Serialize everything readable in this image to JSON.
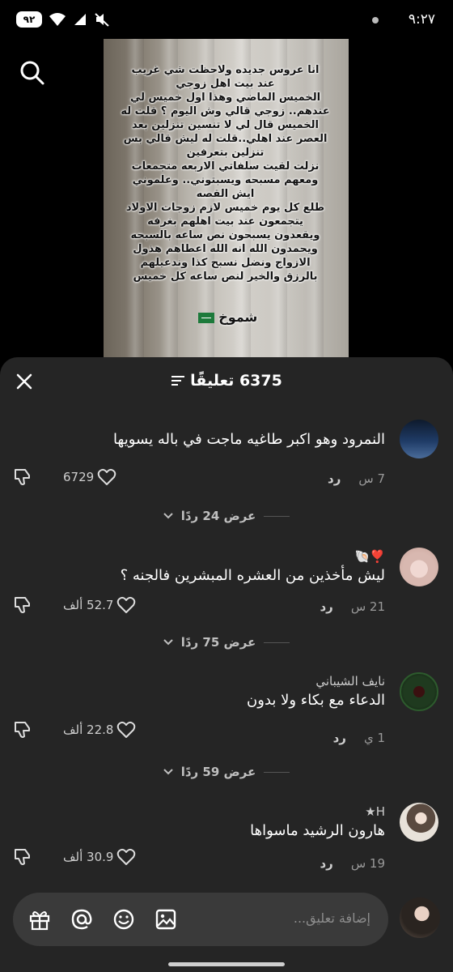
{
  "status_bar": {
    "time": "٩:٢٧",
    "battery": "٩٢"
  },
  "video": {
    "overlay_text": "انا عروس جديده ولاحظت شي غريب\nعند بيت اهل زوجي\nالخميس الماضي وهذا اول خميس لي\nعندهم.. زوجي قالي وش اليوم ؟ قلت له\nالخميس قال لي لا تنسين تنزلين بعد\nالعصر عند اهلي..قلت له ليش قالي بس\nتنزلين بتعرفين\nنزلت لقيت سلفاتي الاربعه متجمعات\nومعهم مسبحه ويسبتوني.. وعلموني\nايش القصه\nطلع كل يوم خميس لازم زوجات الاولاد\nيتجمعون عند بيت اهلهم بغرفه\nويقعدون يسبحون نص ساعه بالسبحه\nويحمدون الله انه الله اعطاهم هذول\nالازواج ونضل نسبح كذا وندعيلهم\nبالرزق والخير لنص ساعه كل خميس",
    "signature": "شموخ"
  },
  "sheet": {
    "count_label": "6375 تعليقًا"
  },
  "comments": [
    {
      "username": "",
      "text": "النمرود وهو اكبر طاغيه ماجت في باله يسويها",
      "time": "7 س",
      "reply": "رد",
      "likes": "6729",
      "replies_label": "عرض 24 ردًا"
    },
    {
      "username": "❣️🐚",
      "text": "ليش مأخذين من العشره المبشرين فالجنه ؟",
      "time": "21 س",
      "reply": "رد",
      "likes": "52.7 ألف",
      "replies_label": "عرض 75 ردًا"
    },
    {
      "username": "نايف الشيباني",
      "text": "الدعاء مع بكاء ولا بدون",
      "time": "1 ي",
      "reply": "رد",
      "likes": "22.8 ألف",
      "replies_label": "عرض 59 ردًا"
    },
    {
      "username": "H★",
      "text": "هارون الرشيد ماسواها",
      "time": "19 س",
      "reply": "رد",
      "likes": "30.9 ألف"
    }
  ],
  "input": {
    "placeholder": "إضافة تعليق..."
  },
  "icons": {
    "search": "search-icon",
    "close": "close-icon",
    "filter": "filter-icon",
    "like": "heart-icon",
    "dislike": "thumbs-down-icon",
    "gift": "gift-icon",
    "mention": "at-icon",
    "emoji": "emoji-icon",
    "image": "image-icon"
  }
}
